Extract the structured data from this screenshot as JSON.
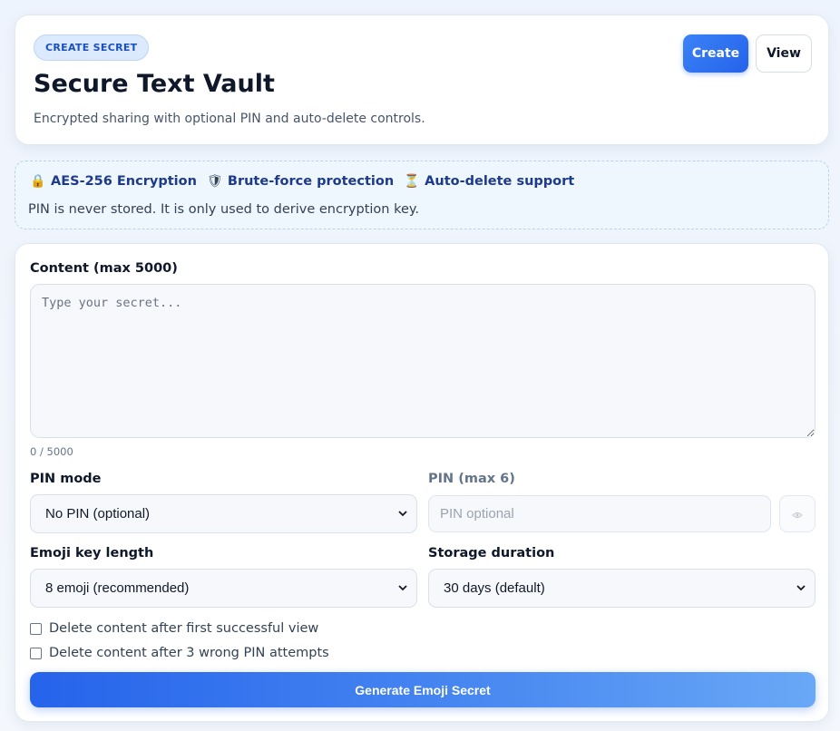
{
  "header": {
    "badge": "CREATE SECRET",
    "title": "Secure Text Vault",
    "subtitle": "Encrypted sharing with optional PIN and auto-delete controls.",
    "create_label": "Create",
    "view_label": "View"
  },
  "info": {
    "features": [
      {
        "icon": "lock-icon",
        "glyph": "🔒",
        "label": "AES-256 Encryption"
      },
      {
        "icon": "shield-icon",
        "glyph": "🛡",
        "label": "Brute-force protection"
      },
      {
        "icon": "hourglass-icon",
        "glyph": "⏳",
        "label": "Auto-delete support"
      }
    ],
    "note": "PIN is never stored. It is only used to derive encryption key."
  },
  "form": {
    "content_label": "Content (max 5000)",
    "content_placeholder": "Type your secret...",
    "content_value": "",
    "char_count": "0 / 5000",
    "pin_mode_label": "PIN mode",
    "pin_mode_value": "No PIN (optional)",
    "pin_label": "PIN (max 6)",
    "pin_placeholder": "PIN optional",
    "emoji_length_label": "Emoji key length",
    "emoji_length_value": "8 emoji (recommended)",
    "storage_label": "Storage duration",
    "storage_value": "30 days (default)",
    "delete_after_view_label": "Delete content after first successful view",
    "delete_after_view_checked": false,
    "delete_after_wrong_pin_label": "Delete content after 3 wrong PIN attempts",
    "delete_after_wrong_pin_checked": false,
    "generate_label": "Generate Emoji Secret"
  },
  "colors": {
    "accent": "#2563eb",
    "badge_bg": "#dbeafe",
    "info_bg": "#eef6fe",
    "feature_text": "#1e3a8a"
  }
}
